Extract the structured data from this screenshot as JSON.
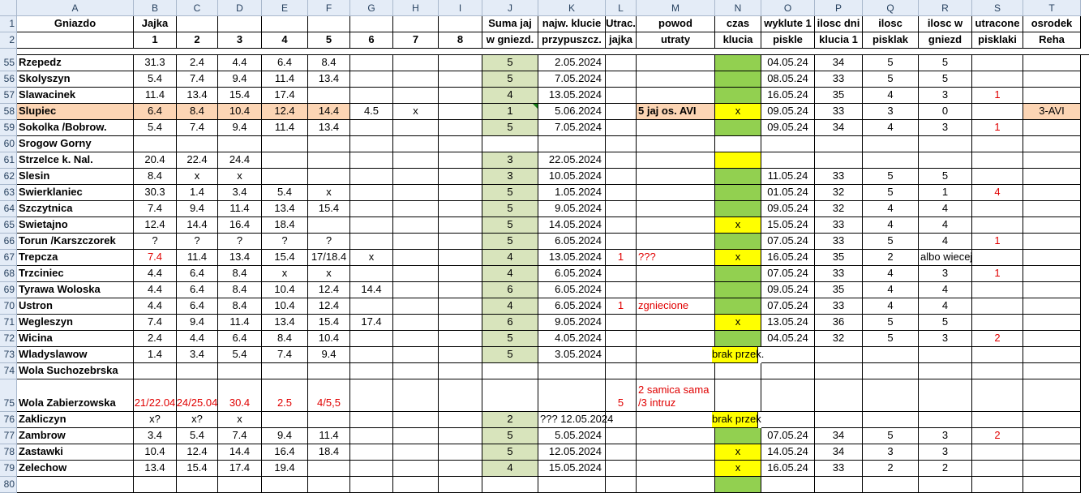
{
  "columns": [
    "A",
    "B",
    "C",
    "D",
    "E",
    "F",
    "G",
    "H",
    "I",
    "J",
    "K",
    "L",
    "M",
    "N",
    "O",
    "P",
    "Q",
    "R",
    "S",
    "T"
  ],
  "colors": {
    "green_light": "#d8e4bc",
    "green": "#92d050",
    "yellow": "#ffff00",
    "peach": "#fcd5b4",
    "red_text": "#e00000"
  },
  "header_rows": [
    {
      "row": "1",
      "cells": [
        "Gniazdo",
        "Jajka",
        "",
        "",
        "",
        "",
        "",
        "",
        "",
        "Suma jaj",
        "najw. klucie",
        "Utrac.",
        "powod",
        "czas",
        "wyklute 1",
        "ilosc dni",
        "ilosc",
        "ilosc w",
        "utracone",
        "osrodek"
      ]
    },
    {
      "row": "2",
      "cells": [
        "",
        "1",
        "2",
        "3",
        "4",
        "5",
        "6",
        "7",
        "8",
        "w gniezd.",
        "przypuszcz.",
        "jajka",
        "utraty",
        "klucia",
        "piskle",
        "klucia 1",
        "pisklak",
        "gniezd",
        "pisklaki",
        "Reha"
      ]
    }
  ],
  "rows": [
    {
      "row": "55",
      "cells": [
        "Rzepedz",
        "31.3",
        "2.4",
        "4.4",
        "6.4",
        "8.4",
        "",
        "",
        "",
        "5",
        "2.05.2024",
        "",
        "",
        "",
        "04.05.24",
        "34",
        "5",
        "5",
        "",
        ""
      ]
    },
    {
      "row": "56",
      "cells": [
        "Skolyszyn",
        "5.4",
        "7.4",
        "9.4",
        "11.4",
        "13.4",
        "",
        "",
        "",
        "5",
        "7.05.2024",
        "",
        "",
        "",
        "08.05.24",
        "33",
        "5",
        "5",
        "",
        ""
      ]
    },
    {
      "row": "57",
      "cells": [
        "Slawacinek",
        "11.4",
        "13.4",
        "15.4",
        "17.4",
        "",
        "",
        "",
        "",
        "4",
        "13.05.2024",
        "",
        "",
        "",
        "16.05.24",
        "35",
        "4",
        "3",
        "1",
        ""
      ]
    },
    {
      "row": "58",
      "cells": [
        "Slupiec",
        "6.4",
        "8.4",
        "10.4",
        "12.4",
        "14.4",
        "4.5",
        "x",
        "",
        "1",
        "5.06.2024",
        "",
        "5 jaj os. AVI",
        "x",
        "09.05.24",
        "33",
        "3",
        "0",
        "",
        "3-AVI"
      ]
    },
    {
      "row": "59",
      "cells": [
        "Sokolka /Bobrow.",
        "5.4",
        "7.4",
        "9.4",
        "11.4",
        "13.4",
        "",
        "",
        "",
        "5",
        "7.05.2024",
        "",
        "",
        "",
        "09.05.24",
        "34",
        "4",
        "3",
        "1",
        ""
      ]
    },
    {
      "row": "60",
      "cells": [
        "Srogow Gorny",
        "",
        "",
        "",
        "",
        "",
        "",
        "",
        "",
        "",
        "",
        "",
        "",
        "",
        "",
        "",
        "",
        "",
        "",
        ""
      ]
    },
    {
      "row": "61",
      "cells": [
        "Strzelce k. Nal.",
        "20.4",
        "22.4",
        "24.4",
        "",
        "",
        "",
        "",
        "",
        "3",
        "22.05.2024",
        "",
        "",
        "",
        "",
        "",
        "",
        "",
        "",
        ""
      ]
    },
    {
      "row": "62",
      "cells": [
        "Slesin",
        "8.4",
        "x",
        "x",
        "",
        "",
        "",
        "",
        "",
        "3",
        "10.05.2024",
        "",
        "",
        "",
        "11.05.24",
        "33",
        "5",
        "5",
        "",
        ""
      ]
    },
    {
      "row": "63",
      "cells": [
        "Swierklaniec",
        "30.3",
        "1.4",
        "3.4",
        "5.4",
        "x",
        "",
        "",
        "",
        "5",
        "1.05.2024",
        "",
        "",
        "",
        "01.05.24",
        "32",
        "5",
        "1",
        "4",
        ""
      ]
    },
    {
      "row": "64",
      "cells": [
        "Szczytnica",
        "7.4",
        "9.4",
        "11.4",
        "13.4",
        "15.4",
        "",
        "",
        "",
        "5",
        "9.05.2024",
        "",
        "",
        "",
        "09.05.24",
        "32",
        "4",
        "4",
        "",
        ""
      ]
    },
    {
      "row": "65",
      "cells": [
        "Swietajno",
        "12.4",
        "14.4",
        "16.4",
        "18.4",
        "",
        "",
        "",
        "",
        "5",
        "14.05.2024",
        "",
        "",
        "x",
        "15.05.24",
        "33",
        "4",
        "4",
        "",
        ""
      ]
    },
    {
      "row": "66",
      "cells": [
        "Torun /Karszczorek",
        "?",
        "?",
        "?",
        "?",
        "?",
        "",
        "",
        "",
        "5",
        "6.05.2024",
        "",
        "",
        "",
        "07.05.24",
        "33",
        "5",
        "4",
        "1",
        ""
      ]
    },
    {
      "row": "67",
      "cells": [
        "Trepcza",
        "7.4",
        "11.4",
        "13.4",
        "15.4",
        "17/18.4",
        "x",
        "",
        "",
        "4",
        "13.05.2024",
        "1",
        "???",
        "x",
        "16.05.24",
        "35",
        "2",
        "albo wiecej",
        "",
        ""
      ]
    },
    {
      "row": "68",
      "cells": [
        "Trzciniec",
        "4.4",
        "6.4",
        "8.4",
        "x",
        "x",
        "",
        "",
        "",
        "4",
        "6.05.2024",
        "",
        "",
        "",
        "07.05.24",
        "33",
        "4",
        "3",
        "1",
        ""
      ]
    },
    {
      "row": "69",
      "cells": [
        "Tyrawa Woloska",
        "4.4",
        "6.4",
        "8.4",
        "10.4",
        "12.4",
        "14.4",
        "",
        "",
        "6",
        "6.05.2024",
        "",
        "",
        "",
        "09.05.24",
        "35",
        "4",
        "4",
        "",
        ""
      ]
    },
    {
      "row": "70",
      "cells": [
        "Ustron",
        "4.4",
        "6.4",
        "8.4",
        "10.4",
        "12.4",
        "",
        "",
        "",
        "4",
        "6.05.2024",
        "1",
        "zgniecione",
        "",
        "07.05.24",
        "33",
        "4",
        "4",
        "",
        ""
      ]
    },
    {
      "row": "71",
      "cells": [
        "Wegleszyn",
        "7.4",
        "9.4",
        "11.4",
        "13.4",
        "15.4",
        "17.4",
        "",
        "",
        "6",
        "9.05.2024",
        "",
        "",
        "x",
        "13.05.24",
        "36",
        "5",
        "5",
        "",
        ""
      ]
    },
    {
      "row": "72",
      "cells": [
        "Wicina",
        "2.4",
        "4.4",
        "6.4",
        "8.4",
        "10.4",
        "",
        "",
        "",
        "5",
        "4.05.2024",
        "",
        "",
        "",
        "04.05.24",
        "32",
        "5",
        "3",
        "2",
        ""
      ]
    },
    {
      "row": "73",
      "cells": [
        "Wladyslawow",
        "1.4",
        "3.4",
        "5.4",
        "7.4",
        "9.4",
        "",
        "",
        "",
        "5",
        "3.05.2024",
        "",
        "",
        "brak przek.",
        "",
        "",
        "",
        "",
        "",
        ""
      ]
    },
    {
      "row": "74",
      "cells": [
        "Wola Suchozebrska",
        "",
        "",
        "",
        "",
        "",
        "",
        "",
        "",
        "",
        "",
        "",
        "",
        "",
        "",
        "",
        "",
        "",
        "",
        ""
      ]
    },
    {
      "row": "75",
      "cells": [
        "Wola Zabierzowska",
        "21/22.04",
        "24/25.04",
        "30.4",
        "2.5",
        "4/5,5",
        "",
        "",
        "",
        "",
        "",
        "5",
        "2 samica sama|/3 intruz",
        "",
        "",
        "",
        "",
        "",
        "",
        ""
      ]
    },
    {
      "row": "76",
      "cells": [
        "Zakliczyn",
        "x?",
        "x?",
        "x",
        "",
        "",
        "",
        "",
        "",
        "2",
        "??? 12.05.2024",
        "",
        "",
        "brak przek",
        "",
        "",
        "",
        "",
        "",
        ""
      ]
    },
    {
      "row": "77",
      "cells": [
        "Zambrow",
        "3.4",
        "5.4",
        "7.4",
        "9.4",
        "11.4",
        "",
        "",
        "",
        "5",
        "5.05.2024",
        "",
        "",
        "",
        "07.05.24",
        "34",
        "5",
        "3",
        "2",
        ""
      ]
    },
    {
      "row": "78",
      "cells": [
        "Zastawki",
        "10.4",
        "12.4",
        "14.4",
        "16.4",
        "18.4",
        "",
        "",
        "",
        "5",
        "12.05.2024",
        "",
        "",
        "x",
        "14.05.24",
        "34",
        "3",
        "3",
        "",
        ""
      ]
    },
    {
      "row": "79",
      "cells": [
        "Zelechow",
        "13.4",
        "15.4",
        "17.4",
        "19.4",
        "",
        "",
        "",
        "",
        "4",
        "15.05.2024",
        "",
        "",
        "x",
        "16.05.24",
        "33",
        "2",
        "2",
        "",
        ""
      ]
    },
    {
      "row": "80",
      "cells": [
        "",
        "",
        "",
        "",
        "",
        "",
        "",
        "",
        "",
        "",
        "",
        "",
        "",
        "",
        "",
        "",
        "",
        "",
        "",
        ""
      ]
    }
  ]
}
